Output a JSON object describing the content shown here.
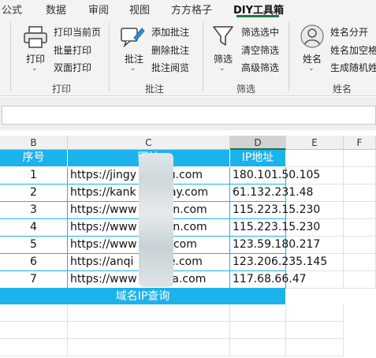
{
  "tabs": [
    {
      "label": "公式",
      "active": false
    },
    {
      "label": "数据",
      "active": false
    },
    {
      "label": "审阅",
      "active": false
    },
    {
      "label": "视图",
      "active": false
    },
    {
      "label": "方方格子",
      "active": false
    },
    {
      "label": "DIY工具箱",
      "active": true
    }
  ],
  "ribbon": {
    "print_group": {
      "big_label": "打印",
      "items": [
        "打印当前页",
        "批量打印",
        "双面打印"
      ],
      "group_label": "打印"
    },
    "comment_group": {
      "big_label": "批注",
      "items": [
        "添加批注",
        "删除批注",
        "批注阅览"
      ],
      "group_label": "批注"
    },
    "filter_group": {
      "big_label": "筛选",
      "items": [
        "筛选选中",
        "清空筛选",
        "高级筛选"
      ],
      "group_label": "筛选"
    },
    "name_group": {
      "big_label": "姓名",
      "items": [
        "姓名分开",
        "姓名加空格",
        "生成随机姓名"
      ],
      "group_label": "姓名"
    }
  },
  "formula_bar": {
    "value": ""
  },
  "columns": [
    "B",
    "C",
    "D",
    "E",
    "F"
  ],
  "selected_column": "D",
  "table": {
    "headers": [
      "序号",
      "网址",
      "IP地址"
    ],
    "rows": [
      {
        "no": "1",
        "url": "https://jingy  idu.com",
        "ip": "180.101.50.105"
      },
      {
        "no": "2",
        "url": "https://kank  tday.com",
        "ip": "61.132.231.48"
      },
      {
        "no": "3",
        "url": "https://www   in.com",
        "ip": "115.223.15.230"
      },
      {
        "no": "4",
        "url": "https://www   in.com",
        "ip": "115.223.15.230"
      },
      {
        "no": "5",
        "url": "https://www   .com",
        "ip": "123.59.180.217"
      },
      {
        "no": "6",
        "url": "https://anqi  uke.com",
        "ip": "123.206.235.145"
      },
      {
        "no": "7",
        "url": "https://www  aya.com",
        "ip": "117.68.66.47"
      }
    ],
    "footer": "域名IP查询"
  },
  "colors": {
    "accent": "#217346",
    "table_header": "#1cb2ec"
  },
  "icons": {
    "print": "printer-icon",
    "comment": "comment-pencil-icon",
    "filter": "funnel-icon",
    "name": "person-icon"
  }
}
